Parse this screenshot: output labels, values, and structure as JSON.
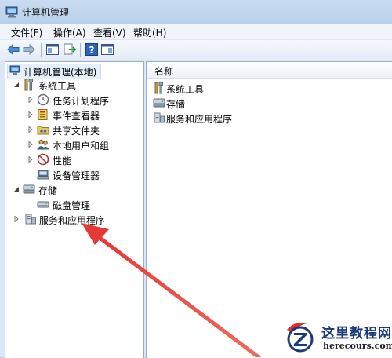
{
  "window": {
    "title": "计算机管理"
  },
  "menu": [
    "文件(F)",
    "操作(A)",
    "查看(V)",
    "帮助(H)"
  ],
  "tree": {
    "root": "计算机管理(本地)",
    "system_tools": "系统工具",
    "task_scheduler": "任务计划程序",
    "event_viewer": "事件查看器",
    "shared_folders": "共享文件夹",
    "local_users": "本地用户和组",
    "performance": "性能",
    "device_manager": "设备管理器",
    "storage": "存储",
    "disk_management": "磁盘管理",
    "services_apps": "服务和应用程序"
  },
  "list": {
    "column_name": "名称",
    "items": [
      "系统工具",
      "存储",
      "服务和应用程序"
    ]
  },
  "watermark": {
    "name": "这里教程网",
    "url": "herecours.com"
  },
  "colors": {
    "arrow": "#e53935",
    "selection": "#e5f0fb",
    "pane_border": "#99b0c9"
  }
}
